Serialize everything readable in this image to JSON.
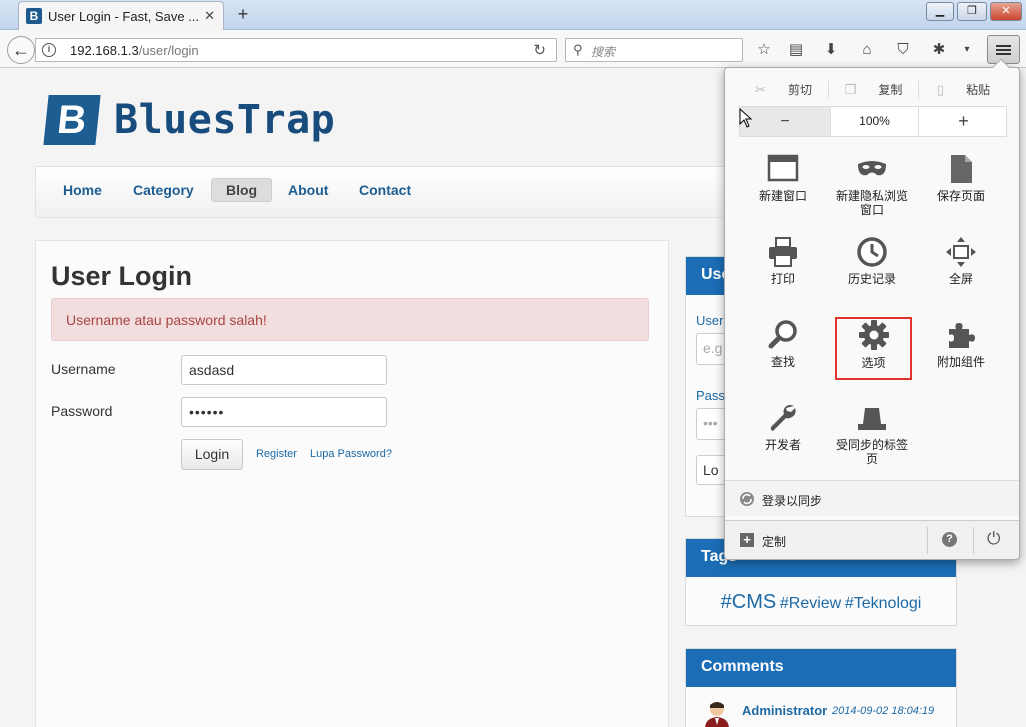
{
  "browser": {
    "tab_title": "User Login - Fast, Save ...",
    "tab_close": "✕",
    "newtab": "+",
    "url_host": "192.168.1.3",
    "url_path": "/user/login",
    "search_placeholder": "搜索",
    "window_buttons": [
      "▁",
      "❐",
      "✕"
    ]
  },
  "site": {
    "logo_mark": "B",
    "logo_text": "BluesTrap",
    "nav": [
      {
        "label": "Home",
        "active": false
      },
      {
        "label": "Category",
        "active": false
      },
      {
        "label": "Blog",
        "active": true
      },
      {
        "label": "About",
        "active": false
      },
      {
        "label": "Contact",
        "active": false
      }
    ],
    "search_icon_text": "S"
  },
  "login": {
    "title": "User Login",
    "alert": "Username atau password salah!",
    "username_label": "Username",
    "username_value": "asdasd",
    "password_label": "Password",
    "password_value": "••••••",
    "login_button": "Login",
    "register_link": "Register",
    "forgot_link": "Lupa Password?"
  },
  "sidebar": {
    "user_head": "Use",
    "user_label1": "Usern",
    "user_placeholder": "e.g",
    "user_label2": "Pass",
    "user_dots": "•••",
    "user_btn": "Lo",
    "tags_head": "Tags",
    "tags": [
      "#CMS",
      "#Review",
      "#Teknologi"
    ],
    "comments_head": "Comments",
    "comment_author": "Administrator",
    "comment_date": "2014-09-02 18:04:19"
  },
  "firefox_menu": {
    "cut": "剪切",
    "copy": "复制",
    "paste": "粘贴",
    "zoom_minus": "−",
    "zoom_value": "100%",
    "zoom_plus": "+",
    "items": [
      {
        "label": "新建窗口",
        "icon": "new-window"
      },
      {
        "label": "新建隐私浏览\n窗口",
        "icon": "private-mask"
      },
      {
        "label": "保存页面",
        "icon": "save-page"
      },
      {
        "label": "打印",
        "icon": "print"
      },
      {
        "label": "历史记录",
        "icon": "history-clock"
      },
      {
        "label": "全屏",
        "icon": "fullscreen"
      },
      {
        "label": "查找",
        "icon": "find-magnifier"
      },
      {
        "label": "选项",
        "icon": "options-gear"
      },
      {
        "label": "附加组件",
        "icon": "addons-puzzle"
      },
      {
        "label": "开发者",
        "icon": "developer-wrench"
      },
      {
        "label": "受同步的标签\n页",
        "icon": "synced-tabs"
      }
    ],
    "sync_label": "登录以同步",
    "customize_label": "定制",
    "help": "?",
    "power": "⏻"
  },
  "colors": {
    "accent": "#1b6db5",
    "alert_bg": "#f2dede",
    "alert_text": "#a94442",
    "highlight_border": "#e0332c"
  }
}
